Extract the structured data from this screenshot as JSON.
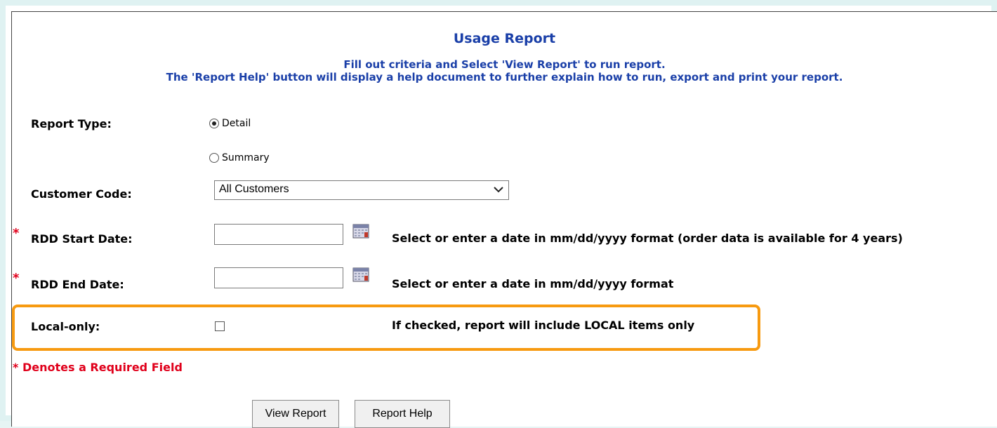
{
  "report": {
    "title": "Usage Report",
    "instruction_line1": "Fill out criteria and Select 'View Report' to run report.",
    "instruction_line2": "The 'Report Help' button will display a help document to further explain how to run, export and print your report."
  },
  "form": {
    "report_type": {
      "label": "Report Type:",
      "options": [
        {
          "label": "Detail",
          "selected": true
        },
        {
          "label": "Summary",
          "selected": false
        }
      ]
    },
    "customer_code": {
      "label": "Customer Code:",
      "selected": "All Customers"
    },
    "rdd_start": {
      "required_marker": "*",
      "label": "RDD Start Date:",
      "value": "",
      "hint": "Select or enter a date in mm/dd/yyyy format (order data is available for 4 years)"
    },
    "rdd_end": {
      "required_marker": "*",
      "label": "RDD End Date:",
      "value": "",
      "hint": "Select or enter a date in mm/dd/yyyy format"
    },
    "local_only": {
      "label": "Local-only:",
      "checked": false,
      "hint": "If checked, report will include LOCAL items only"
    },
    "required_note": {
      "marker": "*",
      "text": "Denotes a Required Field"
    }
  },
  "buttons": {
    "view_report": "View Report",
    "report_help": "Report Help"
  },
  "colors": {
    "accent_blue": "#1a3fa8",
    "required_red": "#e0001b",
    "highlight_orange": "#f79a10"
  },
  "icons": {
    "calendar": "calendar-icon",
    "dropdown": "chevron-down-icon"
  }
}
